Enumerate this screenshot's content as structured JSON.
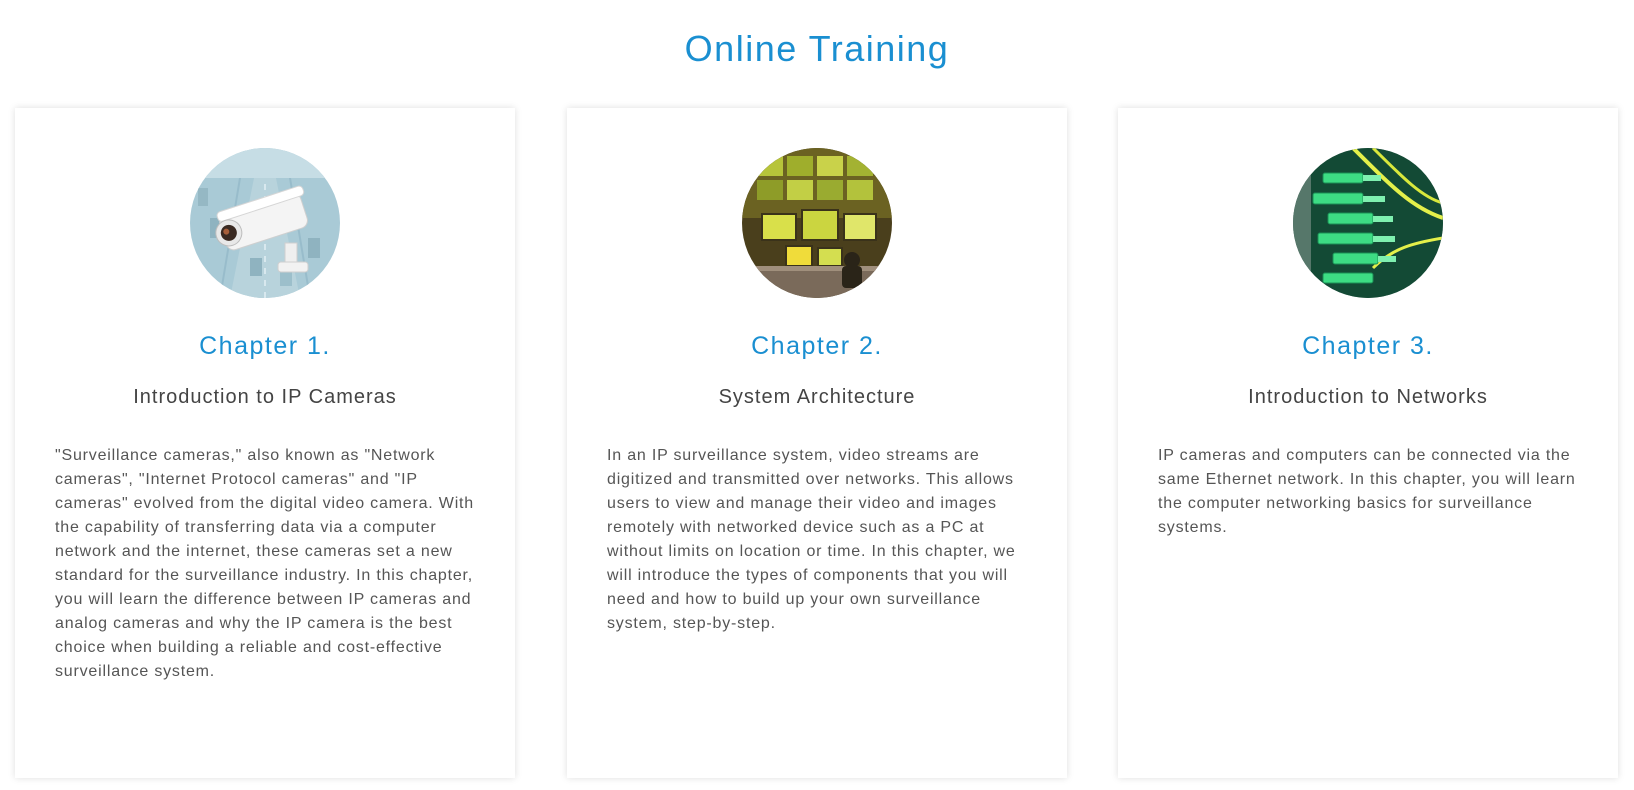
{
  "page": {
    "title": "Online Training"
  },
  "colors": {
    "accent": "#1a8fd1",
    "subtitle": "#444444",
    "body_text": "#555555"
  },
  "cards": [
    {
      "image_icon": "ip-camera-photo",
      "chapter": "Chapter 1.",
      "title": "Introduction to IP Cameras",
      "description": "\"Surveillance cameras,\" also known as \"Network cameras\", \"Internet Protocol cameras\" and \"IP cameras\" evolved from the digital video camera. With the capability of transferring data via a computer network and the internet, these cameras set a new standard for the surveillance industry. In this chapter, you will learn the difference between IP cameras and analog cameras and why the IP camera is the best choice when building a reliable and cost-effective surveillance system."
    },
    {
      "image_icon": "control-room-photo",
      "chapter": "Chapter 2.",
      "title": "System Architecture",
      "description": "In an IP surveillance system, video streams are digitized and transmitted over networks. This allows users to view and manage their video and images remotely with networked device such as a PC at without limits on location or time. In this chapter, we will introduce the types of components that you will need and how to build up your own surveillance system, step-by-step."
    },
    {
      "image_icon": "network-cables-photo",
      "chapter": "Chapter 3.",
      "title": "Introduction to Networks",
      "description": "IP cameras and computers can be connected via the same Ethernet network. In this chapter, you will learn the computer networking basics for surveillance systems."
    }
  ]
}
